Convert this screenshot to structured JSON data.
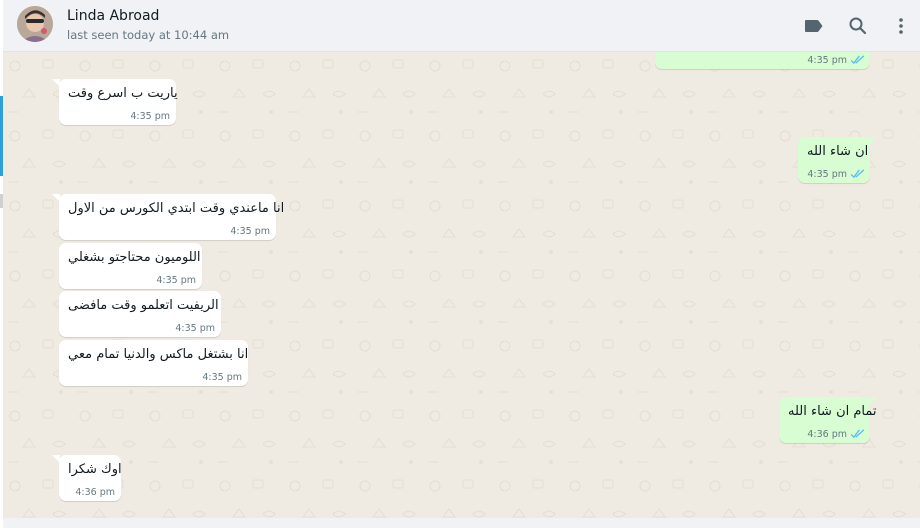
{
  "header": {
    "contact_name": "Linda Abroad",
    "last_seen": "last seen today at 10:44 am",
    "icons": [
      "label-icon",
      "search-icon",
      "menu-icon"
    ]
  },
  "colors": {
    "chat_bg": "#efeae2",
    "incoming_bubble": "#ffffff",
    "outgoing_bubble": "#d9fdd3",
    "read_ticks": "#53bdeb",
    "accent_strip": "#2d9fd9"
  },
  "messages": [
    {
      "direction": "out",
      "text": "",
      "time": "4:35 pm",
      "read": true
    },
    {
      "direction": "in",
      "text": "ياريت ب اسرع وقت",
      "time": "4:35 pm"
    },
    {
      "direction": "out",
      "text": "ان شاء الله",
      "time": "4:35 pm",
      "read": true
    },
    {
      "direction": "in",
      "text": "انا ماعندي وقت ابتدي الكورس من الاول",
      "time": "4:35 pm"
    },
    {
      "direction": "in",
      "text": "اللوميون محتاجتو بشغلي",
      "time": "4:35 pm"
    },
    {
      "direction": "in",
      "text": "الريفيت اتعلمو وقت مافضى",
      "time": "4:35 pm"
    },
    {
      "direction": "in",
      "text": "انا بشتغل ماكس والدنيا تمام معي",
      "time": "4:35 pm"
    },
    {
      "direction": "out",
      "text": "تمام ان شاء الله",
      "time": "4:36 pm",
      "read": true
    },
    {
      "direction": "in",
      "text": "اوك شكرا",
      "time": "4:36 pm"
    }
  ]
}
